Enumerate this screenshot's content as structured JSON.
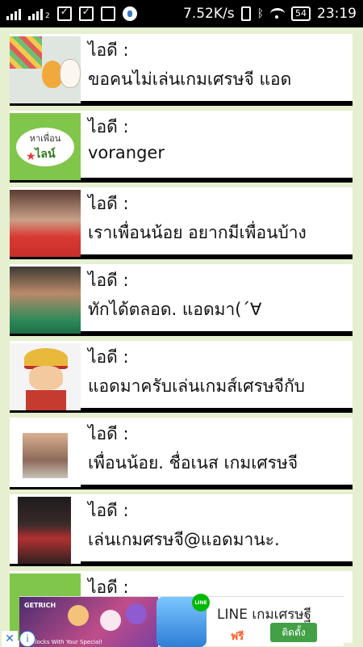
{
  "status_bar": {
    "network_speed": "7.52K/s",
    "battery_level": "54",
    "time": "23:19",
    "icons": [
      "signal-icon",
      "signal-2-icon",
      "clipboard-icon",
      "clipboard-check-icon",
      "image-icon",
      "messenger-icon",
      "vibrate-icon",
      "bluetooth-icon",
      "wifi-icon",
      "battery-icon"
    ]
  },
  "list": {
    "id_label": "ไอดี :",
    "items": [
      {
        "id_label": "ไอดี :",
        "name": "ขอคนไม่เล่นเกมเศรษจี แอด"
      },
      {
        "id_label": "ไอดี :",
        "name": "voranger"
      },
      {
        "id_label": "ไอดี :",
        "name": "เราเพื่อนน้อย อยากมีเพื่อนบ้าง"
      },
      {
        "id_label": "ไอดี :",
        "name": "ทักได้ตลอด. แอดมา(´∀"
      },
      {
        "id_label": "ไอดี :",
        "name": "แอดมาครับเล่นเกมส์เศรษจีกับ"
      },
      {
        "id_label": "ไอดี :",
        "name": "เพื่อนน้อย. ชื่อเนส เกมเศรษจี"
      },
      {
        "id_label": "ไอดี :",
        "name": "เล่นเกมศรษจี@แอดมานะ."
      },
      {
        "id_label": "ไอดี :",
        "name": ""
      }
    ],
    "thumb2_line1": "หาเพื่อน",
    "thumb2_line2": "ไลน์"
  },
  "ad": {
    "title": "LINE เกมเศรษฐี",
    "price": "ฟรี",
    "install_label": "ติดตั้ง",
    "brand": "GETRICH",
    "caption": "All Blocks With Your Special!",
    "badge": "LINE",
    "close_glyph": "✕",
    "info_glyph": "i"
  },
  "colors": {
    "page_bg": "#e6efcf",
    "card_bg": "#ffffff",
    "separator": "#000000",
    "install_green": "#43a047",
    "free_orange": "#ff5722"
  }
}
